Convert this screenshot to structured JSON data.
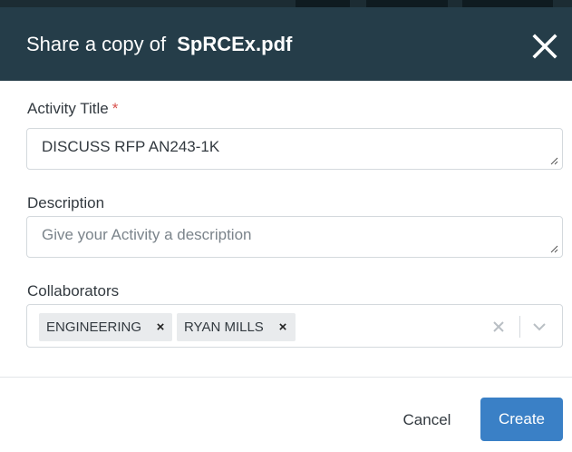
{
  "dialog": {
    "title_prefix": "Share a copy of",
    "file_name": "SpRCEx.pdf"
  },
  "form": {
    "activity_title": {
      "label": "Activity Title",
      "required_marker": "*",
      "value": "DISCUSS RFP AN243-1K"
    },
    "description": {
      "label": "Description",
      "value": "",
      "placeholder": "Give your Activity a description"
    },
    "collaborators": {
      "label": "Collaborators",
      "chips": [
        "ENGINEERING",
        "RYAN MILLS"
      ],
      "chip_remove_glyph": "×"
    }
  },
  "footer": {
    "cancel_label": "Cancel",
    "create_label": "Create"
  },
  "icons": {
    "close": "close-icon",
    "clear": "clear-icon",
    "dropdown": "chevron-down-icon",
    "resize": "resize-handle-icon"
  },
  "colors": {
    "header_bg": "#253d49",
    "primary_button": "#3a80c6",
    "required": "#d9534f",
    "chip_bg": "#e9ebed"
  }
}
